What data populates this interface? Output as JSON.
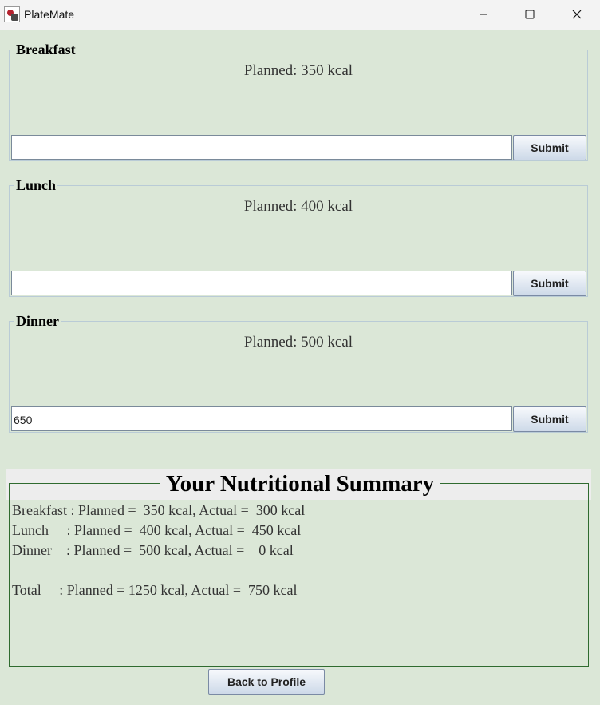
{
  "window": {
    "title": "PlateMate",
    "icon": "platemate-app-icon",
    "controls": [
      "minimize-icon",
      "maximize-icon",
      "close-icon"
    ]
  },
  "meals": [
    {
      "name": "Breakfast",
      "planned": "Planned: 350 kcal",
      "input_value": "",
      "submit_label": "Submit"
    },
    {
      "name": "Lunch",
      "planned": "Planned: 400 kcal",
      "input_value": "",
      "submit_label": "Submit"
    },
    {
      "name": "Dinner",
      "planned": "Planned: 500 kcal",
      "input_value": "650",
      "submit_label": "Submit"
    }
  ],
  "summary": {
    "title": "Your Nutritional Summary",
    "lines": [
      "Breakfast : Planned =  350 kcal, Actual =  300 kcal",
      "Lunch     : Planned =  400 kcal, Actual =  450 kcal",
      "Dinner    : Planned =  500 kcal, Actual =    0 kcal",
      "",
      "Total     : Planned = 1250 kcal, Actual =  750 kcal"
    ]
  },
  "back_button": "Back to Profile",
  "colors": {
    "background": "#dbe7d7",
    "summary_border": "#2f6b2f",
    "panel_border": "#b9cbd6"
  }
}
